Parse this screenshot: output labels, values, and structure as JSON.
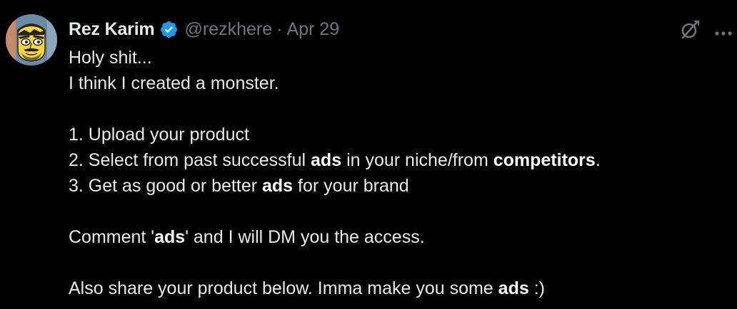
{
  "author": {
    "display_name": "Rez Karim",
    "handle": "@rezkhere",
    "separator": "·",
    "date": "Apr 29",
    "verified": true,
    "verified_color": "#1d9bf0"
  },
  "icons": {
    "verified": "verified-badge-icon",
    "grok": "grok-icon",
    "more": "more-options-icon"
  },
  "tweet": {
    "line1": "Holy shit...",
    "line2": "I think I created a monster.",
    "item1": "1. Upload your product",
    "item2_a": "2. Select from past successful ",
    "item2_b": "ads",
    "item2_c": " in your niche/from ",
    "item2_d": "competitors",
    "item2_e": ".",
    "item3_a": "3. Get as good or better ",
    "item3_b": "ads",
    "item3_c": " for your brand",
    "comment_a": "Comment '",
    "comment_b": "ads",
    "comment_c": "' and I will DM you the access.",
    "share_a": "Also share your product below. Imma make you some ",
    "share_b": "ads",
    "share_c": " :)"
  },
  "colors": {
    "background": "#000000",
    "text": "#e7e9ea",
    "muted": "#71767b",
    "accent": "#1d9bf0"
  }
}
